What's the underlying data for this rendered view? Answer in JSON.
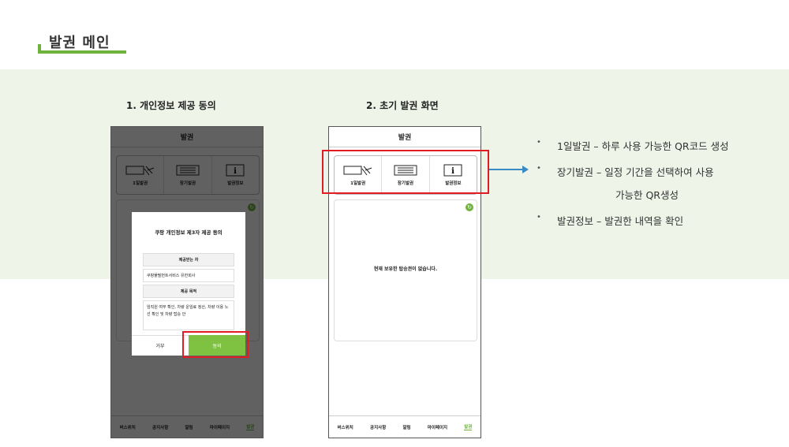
{
  "page": {
    "title": "발권 메인"
  },
  "steps": [
    {
      "label": "1. 개인정보 제공 동의"
    },
    {
      "label": "2. 초기 발권 화면"
    }
  ],
  "phone": {
    "header": "발권",
    "tickets": [
      {
        "label": "1일발권",
        "icon": "ticket-scan-icon"
      },
      {
        "label": "장기발권",
        "icon": "ticket-stack-icon"
      },
      {
        "label": "발권정보",
        "icon": "info-icon"
      }
    ],
    "tabs": [
      "버스위치",
      "공지사항",
      "알림",
      "마이페이지",
      "발권"
    ],
    "active_tab": "발권",
    "empty_message": "현재 보유한 탑승권이 없습니다."
  },
  "consent_modal": {
    "title": "쿠팡 개인정보 제3자 제공 동의",
    "recipient_header": "제공받는 자",
    "recipient_value": "쿠팡풀필먼트서비스 유한회사",
    "purpose_header": "제공 목적",
    "purpose_value": "임직원 여부 확인, 차량 운임료 정산, 차량 이용 노선 확인 및 차량 탑승 안",
    "refuse_label": "거부",
    "agree_label": "동의"
  },
  "description": {
    "items": [
      "1일발권 – 하루 사용 가능한 QR코드 생성",
      "장기발권 – 일정 기간을 선택하여 사용",
      "발권정보 – 발권한 내역을 확인"
    ],
    "continuation": "가능한 QR생성"
  },
  "colors": {
    "accent": "#6fb33d",
    "highlight": "#e31b23",
    "arrow": "#3a8ac6",
    "band": "#eef4e8"
  }
}
